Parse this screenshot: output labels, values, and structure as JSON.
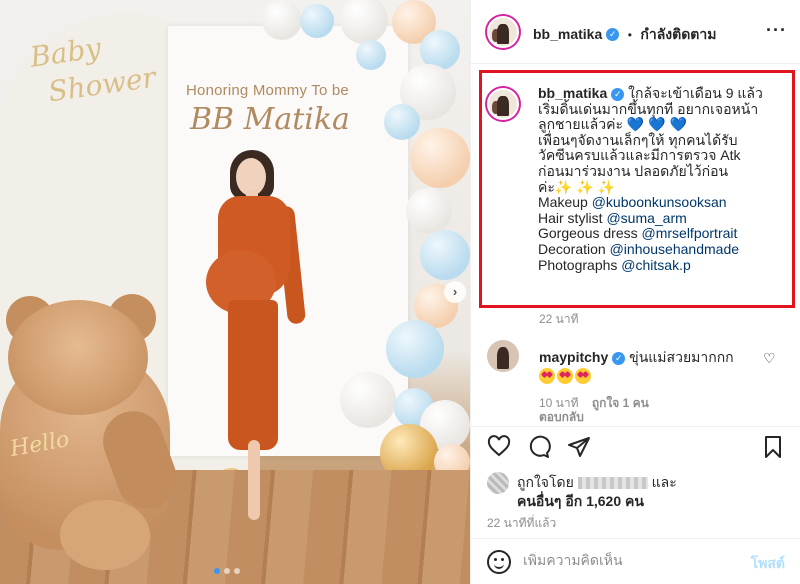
{
  "photo": {
    "sign_cursive_1": "Baby",
    "sign_cursive_2": "Shower",
    "sign_text": "Honoring Mommy To be",
    "sign_name": "BB Matika",
    "bear_sign": "Hello",
    "carousel_next": "›",
    "carousel_dots": 3,
    "carousel_active_dot": 1
  },
  "header": {
    "username": "bb_matika",
    "verified_mark": "✓",
    "separator": "•",
    "follow_label": "กำลังติดตาม",
    "more_label": "···",
    "more_icon": "ellipsis-icon"
  },
  "caption": {
    "username": "bb_matika",
    "verified_mark": "✓",
    "lines": [
      "ใกล้จะเข้าเดือน 9 แล้ว",
      "เริ่มดิ้นเด่นมากขึ้นทุกที อยากเจอหน้า",
      "ลูกชายแล้วค่ะ",
      "เพื่อนๆจัดงานเล็กๆให้ ทุกคนได้รับ",
      "วัคซีนครบแล้วและมีการตรวจ Atk",
      "ก่อนมาร่วมงาน ปลอดภัยไว้ก่อน",
      "ค่ะ"
    ],
    "hearts": "💙 💙 💙",
    "sparkles": "✨ ✨ ✨",
    "credits": [
      {
        "role": "Makeup",
        "handle": "@kuboonkunsooksan"
      },
      {
        "role": "Hair stylist",
        "handle": "@suma_arm"
      },
      {
        "role": "Gorgeous dress",
        "handle": "@mrselfportrait"
      },
      {
        "role": "Decoration",
        "handle": "@inhousehandmade"
      },
      {
        "role": "Photographs",
        "handle": "@chitsak.p"
      }
    ],
    "time": "22 นาที",
    "highlight_color": "#e0141e"
  },
  "comment": {
    "username": "maypitchy",
    "verified_mark": "✓",
    "text": "ขุ่นแม่สวยมากกก",
    "emoji_count": 3,
    "time": "10 นาที",
    "likes": "ถูกใจ 1 คน",
    "reply": "ตอบกลับ",
    "heart_icon": "♡"
  },
  "actions": {
    "like_icon": "♡",
    "comment_icon": "💬",
    "share_icon": "➤",
    "save_icon": "🔖"
  },
  "likes": {
    "prefix": "ถูกใจโดย",
    "suffix": "และ",
    "others": "คนอื่นๆ อีก 1,620 คน",
    "time": "22 นาทีที่แล้ว"
  },
  "comment_input": {
    "placeholder": "เพิ่มความคิดเห็น",
    "post_label": "โพสต์"
  },
  "colors": {
    "link": "#00376b",
    "verified": "#3897f0",
    "post_disabled": "#b2dffc"
  }
}
